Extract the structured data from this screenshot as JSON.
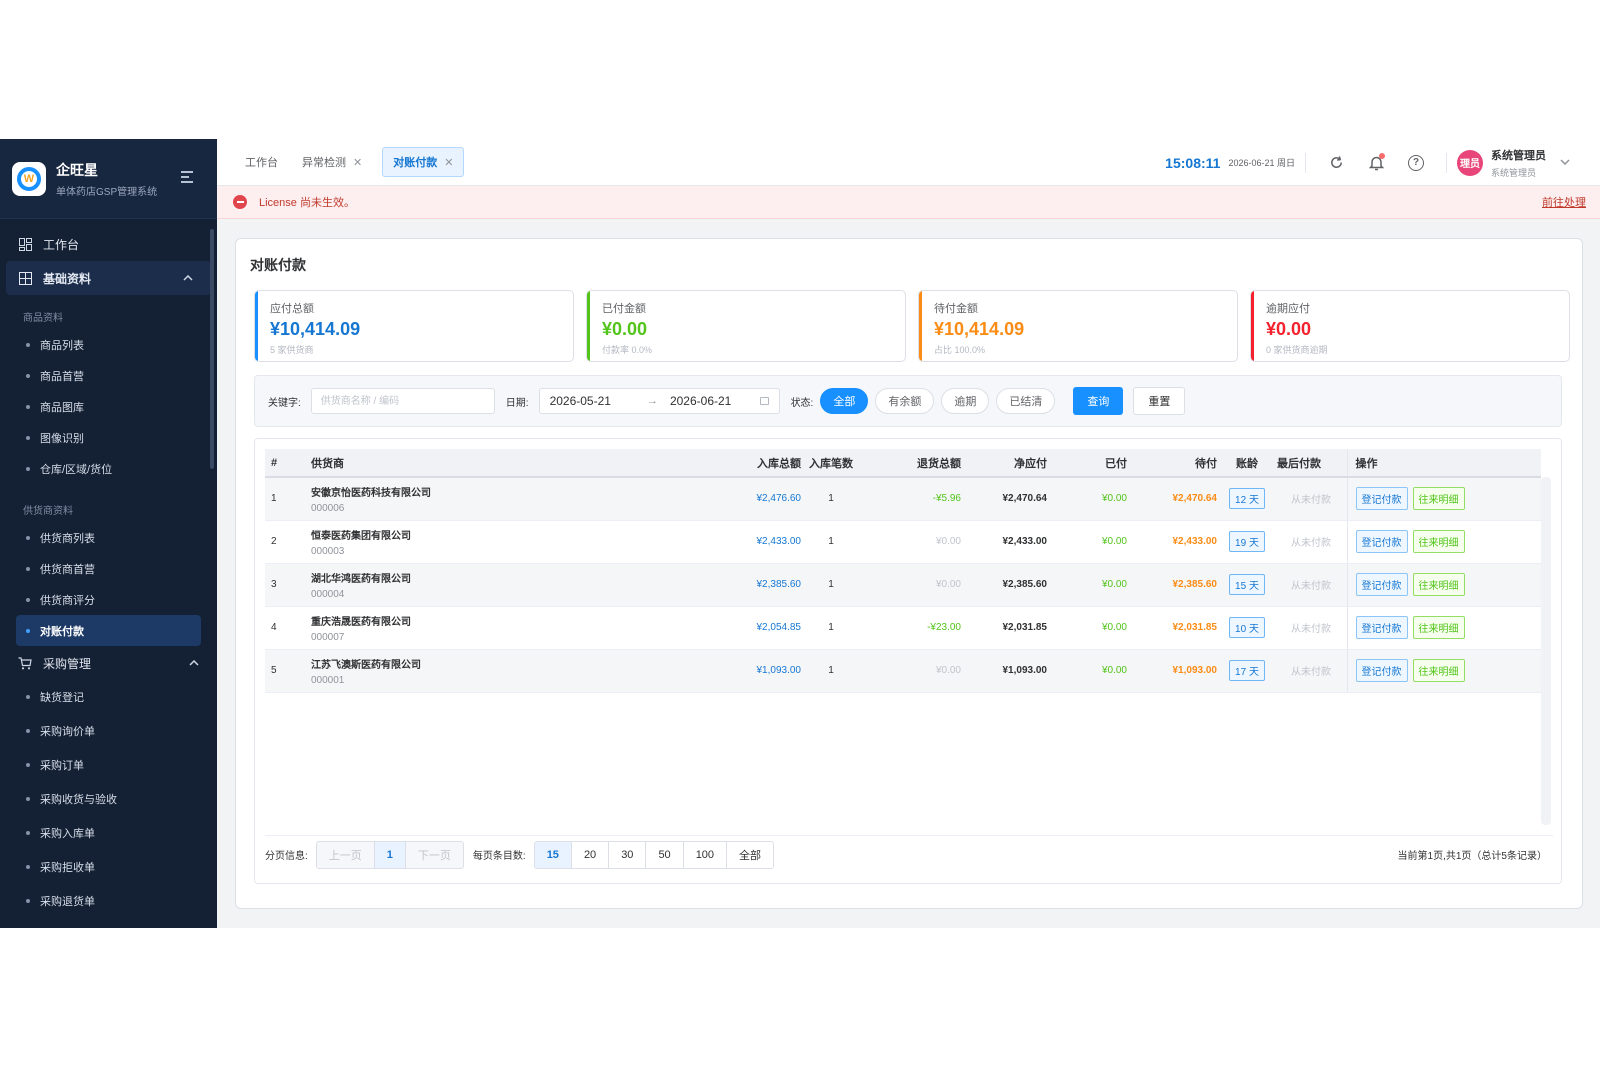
{
  "brand": {
    "name": "企旺星",
    "subtitle": "单体药店GSP管理系统",
    "logo_letter": "W"
  },
  "sidebar": {
    "top_items": [
      {
        "label": "工作台",
        "icon": "dashboard-icon"
      },
      {
        "label": "基础资料",
        "icon": "grid-icon",
        "expanded": true
      }
    ],
    "groups": [
      {
        "title": "商品资料",
        "items": [
          "商品列表",
          "商品首营",
          "商品图库",
          "图像识别",
          "仓库/区域/货位"
        ]
      },
      {
        "title": "供货商资料",
        "items": [
          "供货商列表",
          "供货商首营",
          "供货商评分",
          "对账付款"
        ]
      }
    ],
    "active_item": "对账付款",
    "purchase": {
      "label": "采购管理",
      "icon": "cart-icon",
      "items": [
        "缺货登记",
        "采购询价单",
        "采购订单",
        "采购收货与验收",
        "采购入库单",
        "采购拒收单",
        "采购退货单"
      ]
    }
  },
  "tabs": [
    {
      "label": "工作台",
      "closable": false,
      "active": false
    },
    {
      "label": "异常检测",
      "closable": true,
      "active": false
    },
    {
      "label": "对账付款",
      "closable": true,
      "active": true
    }
  ],
  "header": {
    "clock": "15:08:11",
    "date": "2026-06-21 周日",
    "user_name": "系统管理员",
    "user_role": "系统管理员",
    "avatar_text": "理员"
  },
  "alert": {
    "message": "License 尚未生效。",
    "link": "前往处理"
  },
  "page": {
    "title": "对账付款"
  },
  "stats": [
    {
      "label": "应付总额",
      "value": "¥10,414.09",
      "sub": "5 家供货商",
      "color": "#1890ff"
    },
    {
      "label": "已付金额",
      "value": "¥0.00",
      "sub": "付款率 0.0%",
      "color": "#52c41a"
    },
    {
      "label": "待付金额",
      "value": "¥10,414.09",
      "sub": "占比 100.0%",
      "color": "#fa8c16"
    },
    {
      "label": "逾期应付",
      "value": "¥0.00",
      "sub": "0 家供货商逾期",
      "color": "#f5222d"
    }
  ],
  "filter": {
    "keyword_label": "关键字:",
    "keyword_placeholder": "供货商名称 / 编码",
    "date_label": "日期:",
    "date_from": "2026-05-21",
    "date_to": "2026-06-21",
    "status_label": "状态:",
    "status_options": [
      "全部",
      "有余额",
      "逾期",
      "已结清"
    ],
    "status_selected": "全部",
    "query_label": "查询",
    "reset_label": "重置"
  },
  "table": {
    "headers": [
      "#",
      "供货商",
      "入库总额",
      "入库笔数",
      "退货总额",
      "净应付",
      "已付",
      "待付",
      "账龄",
      "最后付款",
      "操作"
    ],
    "rows": [
      {
        "index": "1",
        "name": "安徽京怡医药科技有限公司",
        "code": "000006",
        "in_total": "¥2,476.60",
        "in_count": "1",
        "return_total": "-¥5.96",
        "net": "¥2,470.64",
        "paid": "¥0.00",
        "pending": "¥2,470.64",
        "age": "12 天",
        "last_pay": "从未付款"
      },
      {
        "index": "2",
        "name": "恒泰医药集团有限公司",
        "code": "000003",
        "in_total": "¥2,433.00",
        "in_count": "1",
        "return_total": "¥0.00",
        "net": "¥2,433.00",
        "paid": "¥0.00",
        "pending": "¥2,433.00",
        "age": "19 天",
        "last_pay": "从未付款"
      },
      {
        "index": "3",
        "name": "湖北华鸿医药有限公司",
        "code": "000004",
        "in_total": "¥2,385.60",
        "in_count": "1",
        "return_total": "¥0.00",
        "net": "¥2,385.60",
        "paid": "¥0.00",
        "pending": "¥2,385.60",
        "age": "15 天",
        "last_pay": "从未付款"
      },
      {
        "index": "4",
        "name": "重庆浩晟医药有限公司",
        "code": "000007",
        "in_total": "¥2,054.85",
        "in_count": "1",
        "return_total": "-¥23.00",
        "net": "¥2,031.85",
        "paid": "¥0.00",
        "pending": "¥2,031.85",
        "age": "10 天",
        "last_pay": "从未付款"
      },
      {
        "index": "5",
        "name": "江苏飞澳斯医药有限公司",
        "code": "000001",
        "in_total": "¥1,093.00",
        "in_count": "1",
        "return_total": "¥0.00",
        "net": "¥1,093.00",
        "paid": "¥0.00",
        "pending": "¥1,093.00",
        "age": "17 天",
        "last_pay": "从未付款"
      }
    ],
    "op_register": "登记付款",
    "op_detail": "往来明细"
  },
  "pager": {
    "info_label": "分页信息:",
    "prev": "上一页",
    "current": "1",
    "next": "下一页",
    "size_label": "每页条目数:",
    "sizes": [
      "15",
      "20",
      "30",
      "50",
      "100",
      "全部"
    ],
    "size_selected": "15",
    "summary": "当前第1页,共1页（总计5条记录）"
  }
}
